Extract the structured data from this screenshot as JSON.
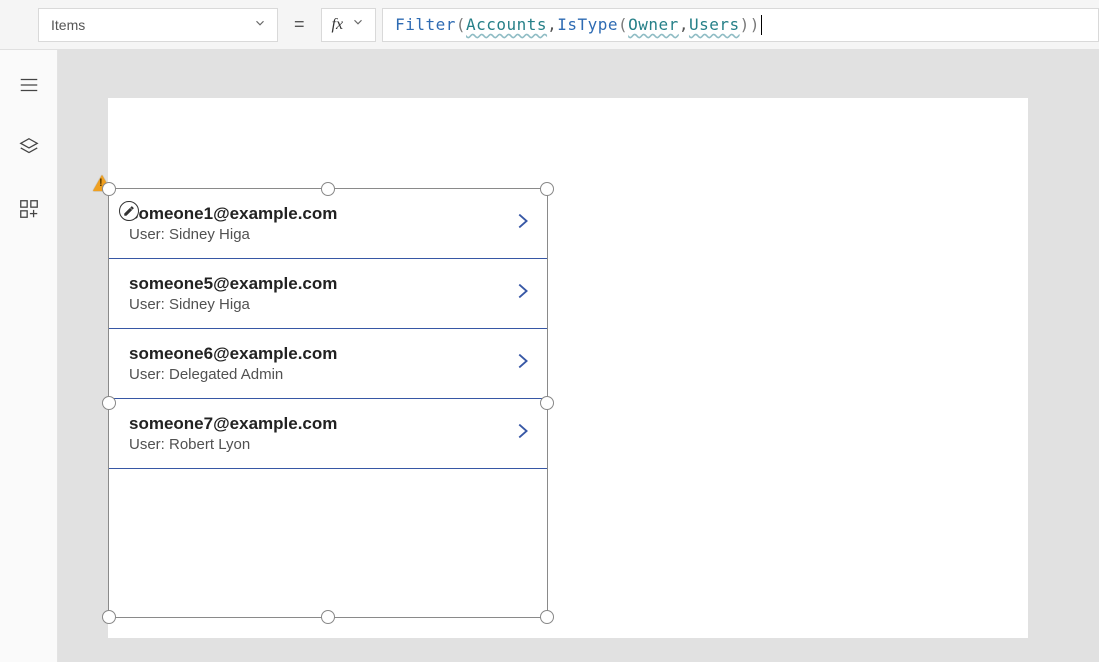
{
  "formula_bar": {
    "property": "Items",
    "equals": "=",
    "fx": "fx",
    "formula_tokens": {
      "fn1": "Filter",
      "open1": "( ",
      "id1": "Accounts",
      "comma1": ", ",
      "fn2": "IsType",
      "open2": "( ",
      "id2": "Owner",
      "comma2": ", ",
      "id3": "Users",
      "sp1": " ",
      "close1": ")",
      "sp2": " ",
      "close2": ")"
    }
  },
  "gallery": {
    "items": [
      {
        "title": "someone1@example.com",
        "sub": "User: Sidney Higa"
      },
      {
        "title": "someone5@example.com",
        "sub": "User: Sidney Higa"
      },
      {
        "title": "someone6@example.com",
        "sub": "User: Delegated Admin"
      },
      {
        "title": "someone7@example.com",
        "sub": "User: Robert Lyon"
      }
    ]
  }
}
